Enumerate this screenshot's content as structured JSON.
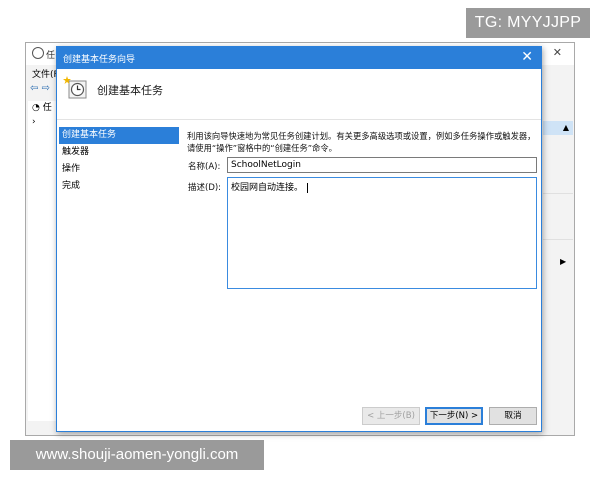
{
  "watermarks": {
    "top": "TG: MYYJJPP",
    "bottom": "www.shouji-aomen-yongli.com"
  },
  "background_window": {
    "title": "任",
    "menu": "文件(F",
    "toolbar": "⇦ ⇨",
    "tree_item": "任",
    "tree_toggle": "›"
  },
  "dialog": {
    "title": "创建基本任务向导",
    "close_glyph": "✕",
    "header": "创建基本任务",
    "steps": [
      "创建基本任务",
      "触发器",
      "操作",
      "完成"
    ],
    "intro": "利用该向导快速地为常见任务创建计划。有关更多高级选项或设置，例如多任务操作或触发器，请使用“操作”窗格中的“创建任务”命令。",
    "name_label": "名称(A):",
    "name_value": "SchoolNetLogin",
    "desc_label": "描述(D):",
    "desc_value": "校园网自动连接。",
    "buttons": {
      "back": "< 上一步(B)",
      "next": "下一步(N) >",
      "cancel": "取消"
    }
  },
  "colors": {
    "accent": "#2b7fd9",
    "watermark_bg": "#9a9a9a"
  }
}
